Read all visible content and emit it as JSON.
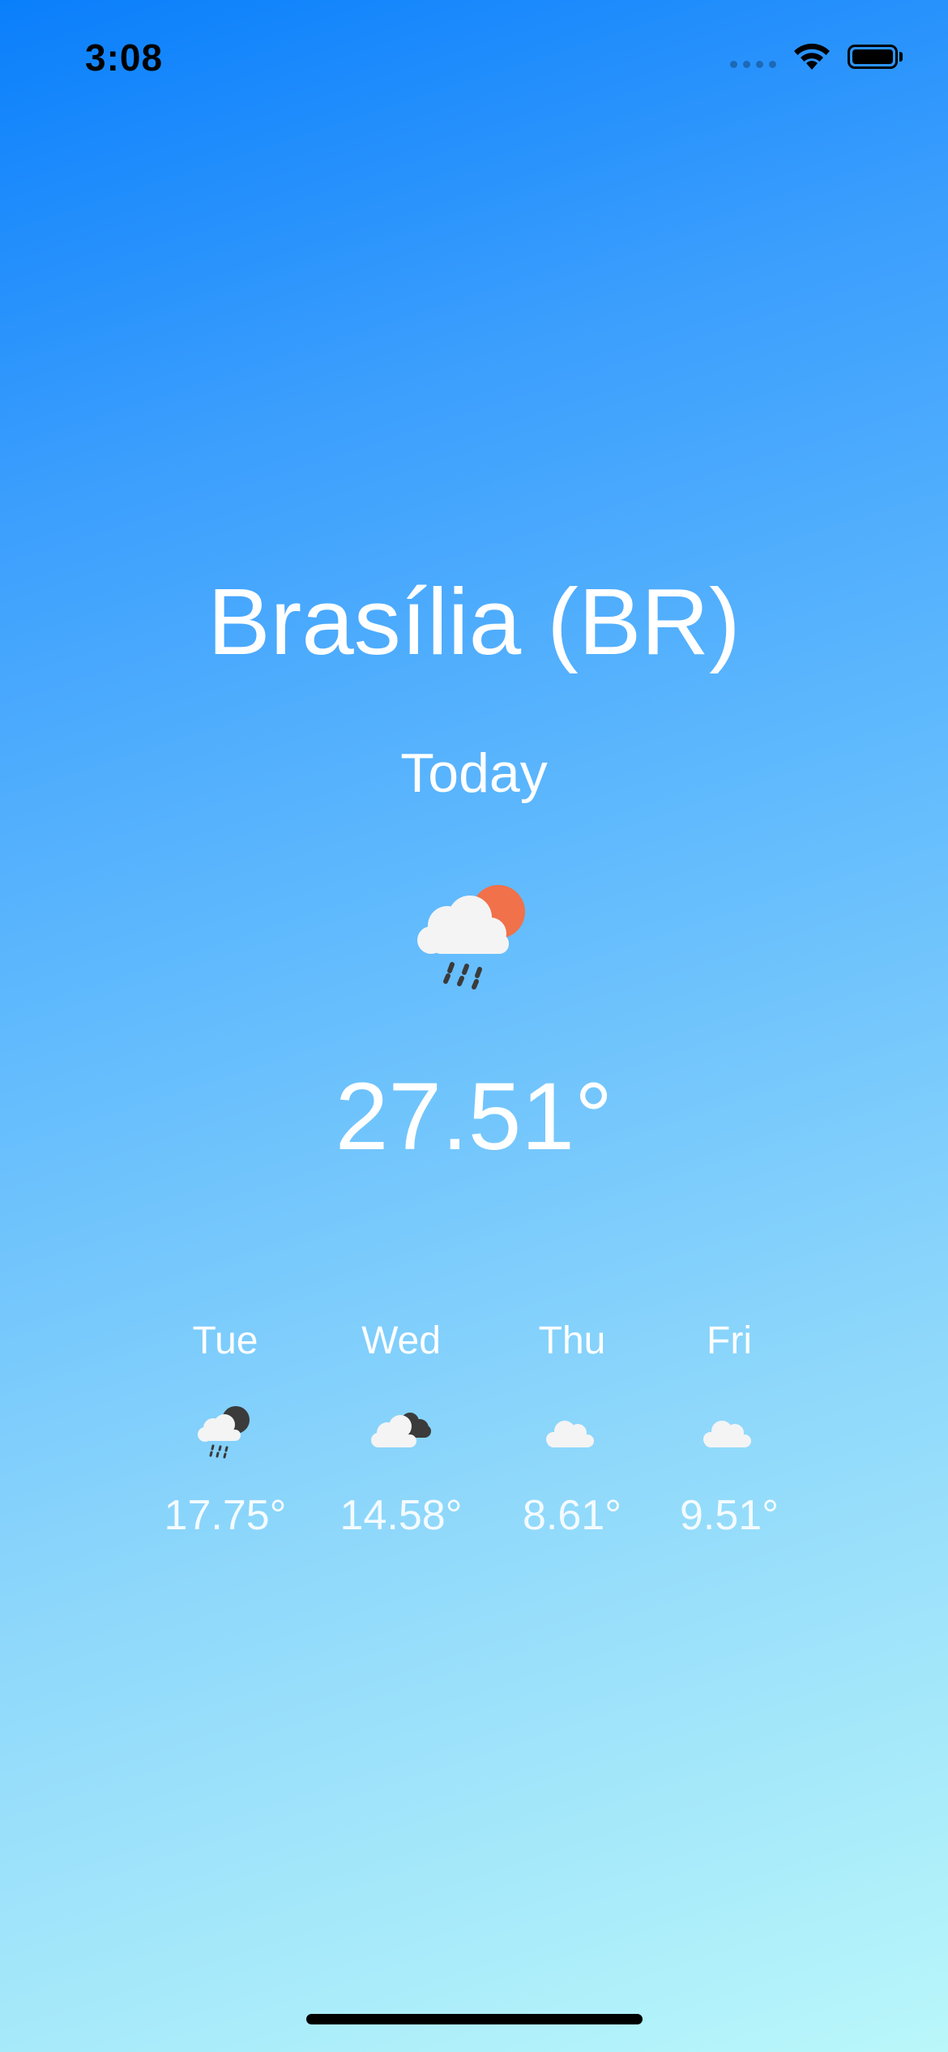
{
  "status_bar": {
    "time": "3:08"
  },
  "location": {
    "title": "Brasília (BR)"
  },
  "today": {
    "label": "Today",
    "icon": "cloud-sun-rain-icon",
    "temperature": "27.51°"
  },
  "forecast": [
    {
      "day": "Tue",
      "icon": "cloud-moon-rain-icon",
      "temperature": "17.75°"
    },
    {
      "day": "Wed",
      "icon": "cloud-dark-cloud-icon",
      "temperature": "14.58°"
    },
    {
      "day": "Thu",
      "icon": "cloud-icon",
      "temperature": "8.61°"
    },
    {
      "day": "Fri",
      "icon": "cloud-icon",
      "temperature": "9.51°"
    }
  ],
  "colors": {
    "gradient_top": "#0a7ffb",
    "gradient_bottom": "#b9f7fa",
    "sun": "#f0714a",
    "cloud": "#f4f4f4",
    "rain": "#444444"
  }
}
